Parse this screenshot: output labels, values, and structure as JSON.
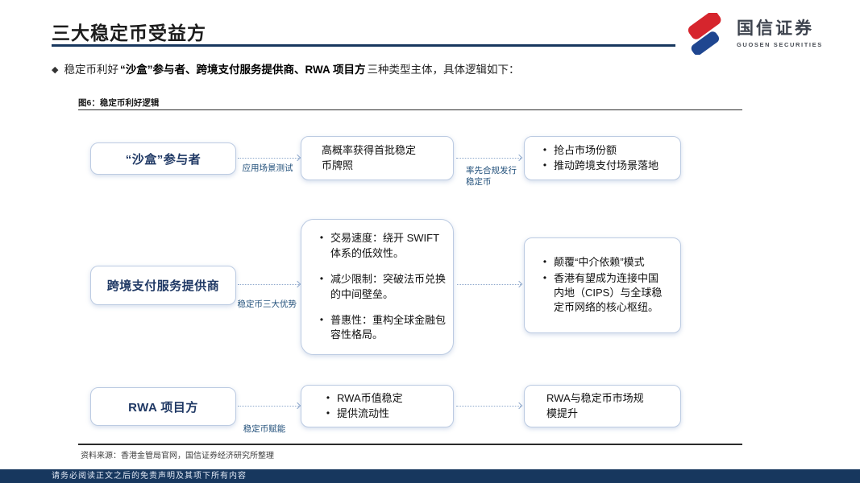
{
  "theme": {
    "title-color": "#1c1c1c",
    "navy": "#17375e",
    "entity-color": "#1f3864",
    "label-color": "#1f4e79",
    "box-border": "#bccbe2",
    "arrow-color": "#8fa9cc",
    "logo-red": "#d6252d",
    "logo-blue": "#1f4690"
  },
  "header": {
    "title": "三大稳定币受益方",
    "logo": {
      "name_cn": "国信证券",
      "name_en": "GUOSEN SECURITIES"
    }
  },
  "intro": {
    "marker": "◆",
    "lead": "稳定币利好",
    "emphasis": "“沙盒”参与者、跨境支付服务提供商、RWA 项目方",
    "tail": "三种类型主体，具体逻辑如下："
  },
  "figure": {
    "caption": "图6：稳定币利好逻辑",
    "source": "资料来源：香港金管局官网，国信证券经济研究所整理"
  },
  "flow": {
    "rows": [
      {
        "entity": "“沙盒”参与者",
        "link1_label": "应用场景测试",
        "middle": {
          "bullets": false,
          "items": [
            "高概率获得首批稳定币牌照"
          ]
        },
        "link2_label": "率先合规发行稳定币",
        "right": {
          "bullets": true,
          "items": [
            "抢占市场份额",
            "推动跨境支付场景落地"
          ]
        }
      },
      {
        "entity": "跨境支付服务提供商",
        "link1_label": "稳定币三大优势",
        "middle": {
          "bullets": true,
          "items": [
            "交易速度：绕开 SWIFT 体系的低效性。",
            "减少限制：突破法币兑换的中间壁垒。",
            "普惠性：重构全球金融包容性格局。"
          ]
        },
        "link2_label": "",
        "right": {
          "bullets": true,
          "items": [
            "颠覆“中介依赖”模式",
            "香港有望成为连接中国内地（CIPS）与全球稳定币网络的核心枢纽。"
          ]
        }
      },
      {
        "entity": "RWA 项目方",
        "link1_label": "稳定币赋能",
        "middle": {
          "bullets": true,
          "items": [
            "RWA币值稳定",
            "提供流动性"
          ]
        },
        "link2_label": "",
        "right": {
          "bullets": false,
          "items": [
            "RWA与稳定币市场规模提升"
          ]
        }
      }
    ]
  },
  "footer": {
    "disclaimer": "请务必阅读正文之后的免责声明及其项下所有内容"
  }
}
